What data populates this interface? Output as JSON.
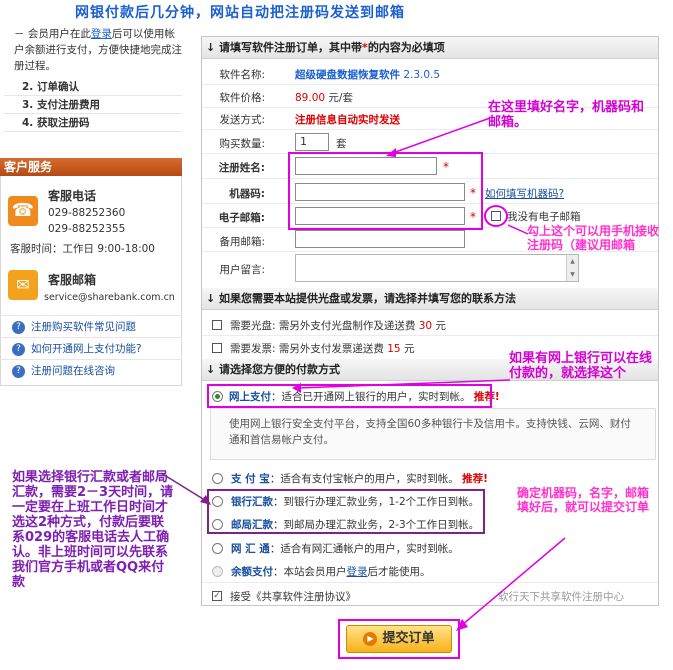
{
  "top_caption": "网银付款后几分钟，网站自动把注册码发送到邮箱",
  "sidebar": {
    "member_note": {
      "prefix": "－ 会员用户在此",
      "login_link": "登录",
      "suffix": "后可以使用帐户余额进行支付，方便快捷地完成注册过程。"
    },
    "steps": [
      "2. 订单确认",
      "3. 支付注册费用",
      "4. 获取注册码"
    ],
    "customer_service_title": "客户服务",
    "phone": {
      "title": "客服电话",
      "numbers": [
        "029-88252360",
        "029-88252355"
      ],
      "hours": "客服时间：工作日 9:00-18:00"
    },
    "email": {
      "title": "客服邮箱",
      "address": "service@sharebank.com.cn"
    },
    "faq": [
      "注册购买软件常见问题",
      "如何开通网上支付功能?",
      "注册问题在线咨询"
    ]
  },
  "order_form": {
    "header_prefix": "请填写软件注册订单，其中带",
    "header_star": "*",
    "header_suffix": "的内容为必填项",
    "product_name_label": "软件名称:",
    "product_name": "超级硬盘数据恢复软件",
    "product_version": "2.3.0.5",
    "price_label": "软件价格:",
    "price_value": "89.00",
    "price_unit": "元/套",
    "shipping_label": "发送方式:",
    "shipping_value": "注册信息自动实时发送",
    "quantity_label": "购买数量:",
    "quantity_value": "1",
    "quantity_unit": "套",
    "reg_name_label": "注册姓名:",
    "machine_code_label": "机器码:",
    "email_label": "电子邮箱:",
    "backup_email_label": "备用邮箱:",
    "message_label": "用户留言:",
    "required_mark": "*",
    "machine_code_help": "如何填写机器码?",
    "no_email_label": "我没有电子邮箱"
  },
  "invoice_section": {
    "header": "如果您需要本站提供光盘或发票，请选择并填写您的联系方法",
    "cd": {
      "label": "需要光盘:",
      "desc": "需另外支付光盘制作及递送费",
      "fee": "30",
      "unit": "元"
    },
    "invoice": {
      "label": "需要发票:",
      "desc": "需另外支付发票递送费",
      "fee": "15",
      "unit": "元"
    }
  },
  "payment_section": {
    "header": "请选择您方便的付款方式",
    "methods": [
      {
        "name": "网上支付",
        "desc": "适合已开通网上银行的用户，实时到帐。",
        "badge": "推荐!"
      },
      {
        "name": "支 付 宝",
        "desc": "适合有支付宝帐户的用户，实时到帐。",
        "badge": "推荐!"
      },
      {
        "name": "银行汇款",
        "desc": "到银行办理汇款业务，1-2个工作日到帐。",
        "badge": ""
      },
      {
        "name": "邮局汇款",
        "desc": "到邮局办理汇款业务，2-3个工作日到帐。",
        "badge": ""
      },
      {
        "name": "网 汇 通",
        "desc": "适合有网汇通帐户的用户，实时到帐。",
        "badge": ""
      },
      {
        "name": "余额支付",
        "desc_prefix": "本站会员用户",
        "desc_link": "登录",
        "desc_suffix": "后才能使用。",
        "badge": ""
      }
    ],
    "online_info": "使用网上银行安全支付平台，支持全国60多种银行卡及信用卡。支持快钱、云网、财付通和首信易帐户支付。",
    "agree_label": "接受《共享软件注册协议》",
    "footer_right": "软行天下共享软件注册中心"
  },
  "submit_label": "提交订单",
  "annotations": {
    "name_note": "在这里填好名字，机器码和邮箱。",
    "phone_note": "勾上这个可以用手机接收注册码（建议用邮箱",
    "online_bank_note": "如果有网上银行可以在线付款的，就选择这个",
    "confirm_note": "确定机器码，名字，邮箱填好后，就可以提交订单",
    "bank_transfer_note": "如果选择银行汇款或者邮局汇款，需要2－3天时间，请一定要在上班工作日时间才选这2种方式，付款后要联系029的客服电话去人工确认。非上班时间可以先联系我们官方手机或者QQ来付款"
  }
}
